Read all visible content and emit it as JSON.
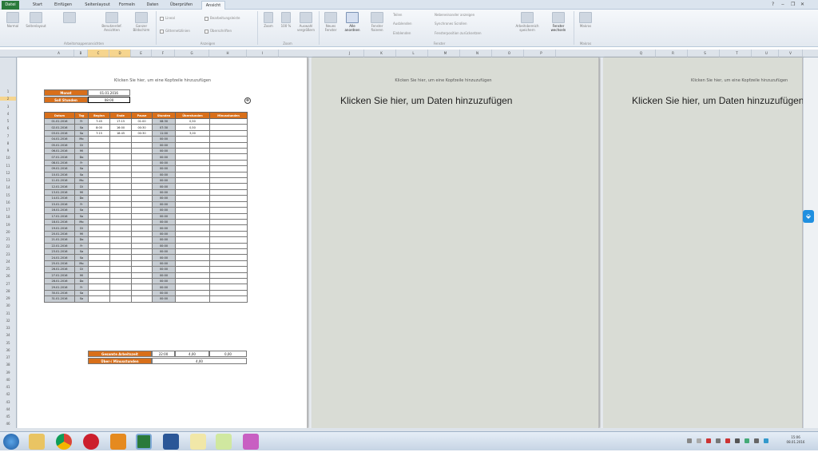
{
  "tabs": {
    "file": "Datei",
    "items": [
      "Start",
      "Einfügen",
      "Seitenlayout",
      "Formeln",
      "Daten",
      "Überprüfen",
      "Ansicht"
    ],
    "active": "Ansicht"
  },
  "ribbon": {
    "buttons": [
      {
        "label": "Normal"
      },
      {
        "label": "Seitenlayout"
      },
      {
        "label": "Benutzerdef. Ansichten"
      },
      {
        "label": "Ganzer Bildschirm"
      },
      {
        "label": "Zoom"
      },
      {
        "label": "100 %"
      },
      {
        "label": "Auswahl vergrößern"
      },
      {
        "label": "Neues Fenster"
      },
      {
        "label": "Alle anordnen"
      },
      {
        "label": "Fenster fixieren"
      },
      {
        "label": "Arbeitsbereich speichern"
      },
      {
        "label": "Fenster wechseln"
      },
      {
        "label": "Makros"
      }
    ],
    "checks": [
      "Lineal",
      "Gitternetzlinien",
      "Bearbeitungsleiste",
      "Überschriften"
    ],
    "window_small": [
      "Teilen",
      "Ausblenden",
      "Einblenden",
      "Nebeneinander anzeigen",
      "Synchrones Scrollen",
      "Fensterposition zurücksetzen"
    ],
    "groups": [
      "Arbeitsmappenansichten",
      "Anzeigen",
      "Zoom",
      "Fenster",
      "Makros"
    ]
  },
  "columns": [
    "A",
    "B",
    "C",
    "D",
    "E",
    "F",
    "G",
    "H",
    "I"
  ],
  "columns_page2": [
    "J",
    "K",
    "L",
    "M",
    "N",
    "O",
    "P"
  ],
  "columns_page3": [
    "Q",
    "R",
    "S",
    "T",
    "U",
    "V"
  ],
  "page": {
    "header_hint": "Klicken Sie hier, um eine Kopfzeile hinzuzufügen",
    "add_data": "Klicken Sie hier, um Daten hinzuzufügen"
  },
  "info": {
    "monat_label": "Monat",
    "monat_value": "01.01.2016",
    "soll_label": "Soll Stunden",
    "soll_value": "08:00"
  },
  "table": {
    "headers": [
      "Datum",
      "Tag",
      "Beginn",
      "Ende",
      "Pause",
      "Stunden",
      "Überstunden",
      "Minusstunden"
    ],
    "rows": [
      [
        "01.01.2016",
        "Fr",
        "7:45",
        "17:15",
        "01:00",
        "08:30",
        "0,50",
        ""
      ],
      [
        "02.01.2016",
        "Sa",
        "8:00",
        "16:00",
        "00:30",
        "07:30",
        "0,50",
        ""
      ],
      [
        "03.01.2016",
        "So",
        "7:15",
        "18:45",
        "00:30",
        "11:00",
        "3,00",
        ""
      ],
      [
        "04.01.2016",
        "Mo",
        "",
        "",
        "",
        "00:00",
        "",
        ""
      ],
      [
        "05.01.2016",
        "Di",
        "",
        "",
        "",
        "00:00",
        "",
        ""
      ],
      [
        "06.01.2016",
        "Mi",
        "",
        "",
        "",
        "00:00",
        "",
        ""
      ],
      [
        "07.01.2016",
        "Do",
        "",
        "",
        "",
        "00:00",
        "",
        ""
      ],
      [
        "08.01.2016",
        "Fr",
        "",
        "",
        "",
        "00:00",
        "",
        ""
      ],
      [
        "09.01.2016",
        "Sa",
        "",
        "",
        "",
        "00:00",
        "",
        ""
      ],
      [
        "10.01.2016",
        "So",
        "",
        "",
        "",
        "00:00",
        "",
        ""
      ],
      [
        "11.01.2016",
        "Mo",
        "",
        "",
        "",
        "00:00",
        "",
        ""
      ],
      [
        "12.01.2016",
        "Di",
        "",
        "",
        "",
        "00:00",
        "",
        ""
      ],
      [
        "13.01.2016",
        "Mi",
        "",
        "",
        "",
        "00:00",
        "",
        ""
      ],
      [
        "14.01.2016",
        "Do",
        "",
        "",
        "",
        "00:00",
        "",
        ""
      ],
      [
        "15.01.2016",
        "Fr",
        "",
        "",
        "",
        "00:00",
        "",
        ""
      ],
      [
        "16.01.2016",
        "Sa",
        "",
        "",
        "",
        "00:00",
        "",
        ""
      ],
      [
        "17.01.2016",
        "So",
        "",
        "",
        "",
        "00:00",
        "",
        ""
      ],
      [
        "18.01.2016",
        "Mo",
        "",
        "",
        "",
        "00:00",
        "",
        ""
      ],
      [
        "19.01.2016",
        "Di",
        "",
        "",
        "",
        "00:00",
        "",
        ""
      ],
      [
        "20.01.2016",
        "Mi",
        "",
        "",
        "",
        "00:00",
        "",
        ""
      ],
      [
        "21.01.2016",
        "Do",
        "",
        "",
        "",
        "00:00",
        "",
        ""
      ],
      [
        "22.01.2016",
        "Fr",
        "",
        "",
        "",
        "00:00",
        "",
        ""
      ],
      [
        "23.01.2016",
        "Sa",
        "",
        "",
        "",
        "00:00",
        "",
        ""
      ],
      [
        "24.01.2016",
        "So",
        "",
        "",
        "",
        "00:00",
        "",
        ""
      ],
      [
        "25.01.2016",
        "Mo",
        "",
        "",
        "",
        "00:00",
        "",
        ""
      ],
      [
        "26.01.2016",
        "Di",
        "",
        "",
        "",
        "00:00",
        "",
        ""
      ],
      [
        "27.01.2016",
        "Mi",
        "",
        "",
        "",
        "00:00",
        "",
        ""
      ],
      [
        "28.01.2016",
        "Do",
        "",
        "",
        "",
        "00:00",
        "",
        ""
      ],
      [
        "29.01.2016",
        "Fr",
        "",
        "",
        "",
        "00:00",
        "",
        ""
      ],
      [
        "30.01.2016",
        "Sa",
        "",
        "",
        "",
        "00:00",
        "",
        ""
      ],
      [
        "31.01.2016",
        "So",
        "",
        "",
        "",
        "00:00",
        "",
        ""
      ]
    ]
  },
  "summary": {
    "gesamt_label": "Gesamte Arbeitszeit",
    "gesamt_stunden": "22:00",
    "gesamt_ueber": "4,00",
    "gesamt_minus": "0,00",
    "ueber_minus_label": "Über-/ Minusstunden",
    "ueber_minus_value": "4,00"
  },
  "row_numbers": [
    "1",
    "2",
    "3",
    "4",
    "5",
    "6",
    "7",
    "8",
    "9",
    "10",
    "11",
    "12",
    "13",
    "14",
    "15",
    "16",
    "17",
    "18",
    "19",
    "20",
    "21",
    "22",
    "23",
    "24",
    "25",
    "26",
    "27",
    "28",
    "29",
    "30",
    "31",
    "32",
    "33",
    "34",
    "35",
    "36",
    "37",
    "38",
    "39",
    "40",
    "41",
    "42",
    "43",
    "44",
    "45",
    "46",
    "47",
    "48"
  ],
  "taskbar": {
    "time": "15:06",
    "date": "08.01.2016"
  },
  "colors": {
    "orange": "#d86f1a",
    "excel_green": "#2a7a3b",
    "dropbox_blue": "#1f8fe0"
  }
}
